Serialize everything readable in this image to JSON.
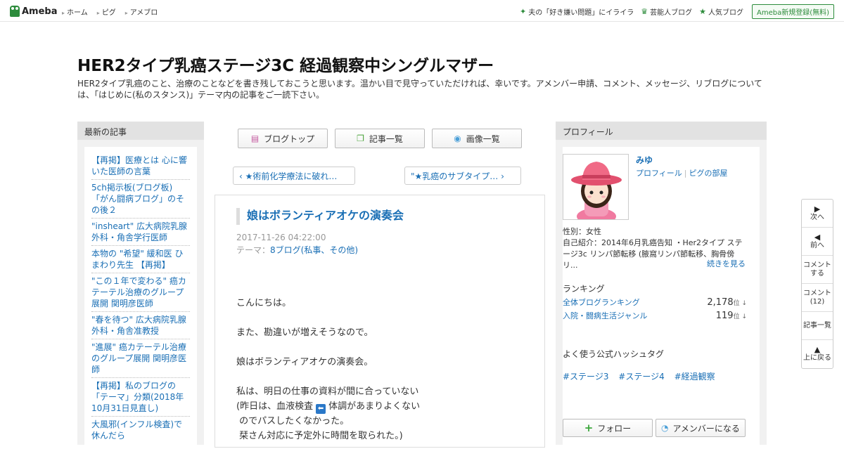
{
  "header": {
    "logo_text": "Ameba",
    "nav": [
      "ホーム",
      "ピグ",
      "アメブロ"
    ],
    "right_links": [
      {
        "icon": "sparkle-icon",
        "label": "夫の「好き嫌い問題」にイライラ"
      },
      {
        "icon": "crown-icon",
        "label": "芸能人ブログ"
      },
      {
        "icon": "star-icon",
        "label": "人気ブログ"
      }
    ],
    "register_label": "Ameba新規登録(無料)"
  },
  "blog": {
    "title": "HER2タイプ乳癌ステージ3C 経過観察中シングルマザー",
    "description": "HER2タイプ乳癌のこと、治療のことなどを書き残しておこうと思います。温かい目で見守っていただければ、幸いです。アメンバー申請、コメント、メッセージ、リブログについては、「はじめに(私のスタンス)」テーマ内の記事をご一読下さい。"
  },
  "left": {
    "heading": "最新の記事",
    "items": [
      "【再掲】医療とは 心に響いた医師の言葉",
      "5ch掲示板(ブログ板) 「がん闘病ブログ」のその後２",
      "\"insheart\" 広大病院乳腺外科・角舎学行医師",
      "本物の \"希望\" 緩和医 ひまわり先生 【再掲】",
      "\"この１年で変わる\" 癌カテーテル治療のグループ展開 関明彦医師",
      "\"春を待つ\" 広大病院乳腺外科・角舎准教授",
      "\"進展\" 癌カテーテル治療のグループ展開 関明彦医師",
      "【再掲】私のブログの「テーマ」分類(2018年10月31日見直し)",
      "大風邪(インフル検査)で休んだら"
    ]
  },
  "tabs": [
    {
      "icon": "document-icon",
      "label": "ブログトップ"
    },
    {
      "icon": "copy-icon",
      "label": "記事一覧"
    },
    {
      "icon": "camera-icon",
      "label": "画像一覧"
    }
  ],
  "pager": {
    "prev": "‹ ★術前化学療法に破れ…",
    "next": "\"★乳癌のサブタイプ… ›"
  },
  "article": {
    "title": "娘はボランティアオケの演奏会",
    "date": "2017-11-26 04:22:00",
    "theme_prefix": "テーマ：",
    "theme": "8ブログ(私事、その他)",
    "lines": [
      "こんにちは。",
      "",
      "また、勘違いが増えそうなので。",
      "",
      "娘はボランティアオケの演奏会。",
      "",
      "私は、明日の仕事の資料が間に合っていない",
      "(昨日は、血液検査",
      " のでパスしたくなかった。",
      " 栞さん対応に予定外に時間を取られた。)"
    ],
    "line8_after": "体調があまりよくない",
    "emoji_glyph": "⬅"
  },
  "profile": {
    "heading": "プロフィール",
    "name": "みゆ",
    "link_profile": "プロフィール",
    "link_pig": "ピグの部屋",
    "gender": "性別：女性",
    "intro": "自己紹介：2014年6月乳癌告知 ・Her2タイプ ステージ3c リンパ節転移 (腋窩リンパ節転移、胸骨傍リ...",
    "more": "続きを見る",
    "ranking_heading": "ランキング",
    "rankings": [
      {
        "label": "全体ブログランキング",
        "value": "2,178",
        "unit": "位 ↓"
      },
      {
        "label": "入院・闘病生活ジャンル",
        "value": "119",
        "unit": "位 ↓"
      }
    ],
    "hashtag_heading": "よく使う公式ハッシュタグ",
    "hashtags": [
      "#ステージ3",
      "#ステージ4",
      "#経過観察"
    ],
    "follow_label": "フォロー",
    "amember_label": "アメンバーになる"
  },
  "sidenav": [
    {
      "icon": "next-icon",
      "glyph": "▶",
      "label": "次へ"
    },
    {
      "icon": "prev-icon",
      "glyph": "◀",
      "label": "前へ"
    },
    {
      "icon": "",
      "glyph": "",
      "label": "コメント\nする"
    },
    {
      "icon": "",
      "glyph": "",
      "label": "コメント\n(12)"
    },
    {
      "icon": "",
      "glyph": "",
      "label": "記事一覧"
    },
    {
      "icon": "top-icon",
      "glyph": "▲",
      "label": "上に戻る"
    }
  ],
  "colors": {
    "brand_green": "#2d8c3c",
    "link_blue": "#1a6fb5"
  }
}
